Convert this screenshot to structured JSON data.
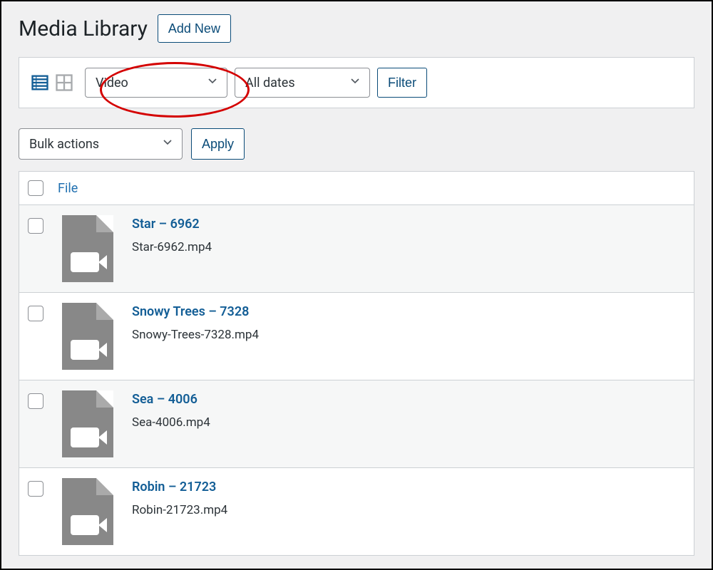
{
  "header": {
    "title": "Media Library",
    "add_new_label": "Add New"
  },
  "filters": {
    "type_select": "Video",
    "date_select": "All dates",
    "filter_button": "Filter"
  },
  "bulk": {
    "select": "Bulk actions",
    "apply": "Apply"
  },
  "table": {
    "file_header": "File",
    "rows": [
      {
        "title": "Star – 6962",
        "filename": "Star-6962.mp4"
      },
      {
        "title": "Snowy Trees – 7328",
        "filename": "Snowy-Trees-7328.mp4"
      },
      {
        "title": "Sea – 4006",
        "filename": "Sea-4006.mp4"
      },
      {
        "title": "Robin – 21723",
        "filename": "Robin-21723.mp4"
      }
    ]
  },
  "colors": {
    "accent": "#2271b1",
    "annotation": "#d40000"
  }
}
